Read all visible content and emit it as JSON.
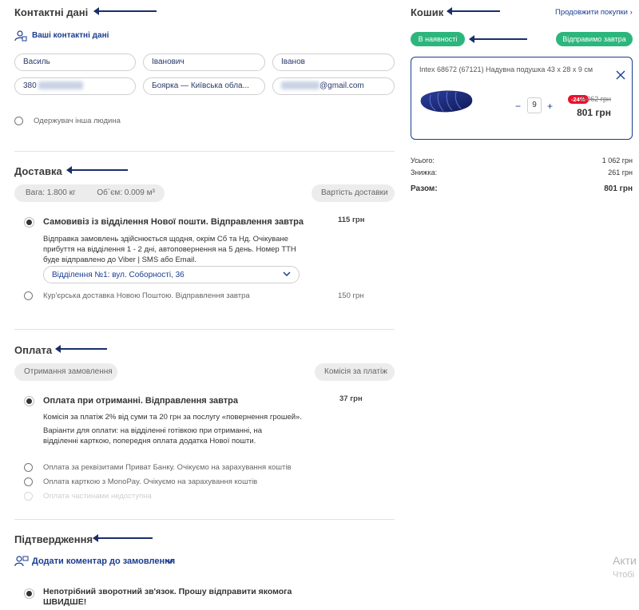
{
  "contacts": {
    "title": "Контактні дані",
    "your_contacts": "Ваші контактні дані",
    "first_name": "Василь",
    "patronymic": "Іванович",
    "last_name": "Іванов",
    "phone_prefix": "380",
    "city": "Боярка — Київська обла...",
    "email_suffix": "@gmail.com",
    "other_recipient": "Одержувач інша людина"
  },
  "delivery": {
    "title": "Доставка",
    "weight": "Вага: 1.800 кг",
    "volume": "Об`єм: 0.009 м³",
    "cost_button": "Вартість доставки",
    "option1": {
      "label": "Самовивіз із відділення Нової пошти. Відправлення завтра",
      "price": "115 грн",
      "description": "Відправка замовлень здійснюється щодня, окрім Сб та Нд. Очікуване прибуття на відділення 1 - 2 дні, автоповернення на 5 день. Номер ТТН буде відправлено до Viber | SMS або Email.",
      "branch": "Відділення №1: вул. Соборності, 36"
    },
    "option2": {
      "label": "Кур'єрська доставка Новою Поштою. Відправлення завтра",
      "price": "150 грн"
    }
  },
  "payment": {
    "title": "Оплата",
    "receive_button": "Отримання замовлення",
    "commission_button": "Комісія за платіж",
    "option1": {
      "label": "Оплата при отриманні. Відправлення завтра",
      "price": "37 грн",
      "line1": "Комісія за платіж 2% від суми та 20 грн за послугу «повернення грошей».",
      "line2": "Варіанти для оплати: на відділенні готівкою при отриманні, на відділенні карткою, попередня оплата додатка Нової пошти."
    },
    "option2": "Оплата за реквізитами Приват Банку. Очікуємо на зарахування коштів",
    "option3": "Оплата карткою з MonoPay. Очікуємо на зарахування коштів",
    "option4": "Оплата частинами недоступна"
  },
  "confirmation": {
    "title": "Підтвердження",
    "add_comment": "Додати коментар до замовлення",
    "no_callback": "Непотрібний зворотний зв'язок. Прошу відправити якомога ШВИДШЕ!"
  },
  "cart": {
    "title": "Кошик",
    "continue": "Продовжити покупки",
    "in_stock": "В наявності",
    "ship_tomorrow": "Відправимо завтра",
    "product_name": "Intex 68672 (67121) Надувна подушка 43 х 28 х 9 см",
    "quantity": "9",
    "discount_badge": "-24%",
    "old_price": "1 062 грн",
    "price": "801 грн",
    "total_label": "Усього:",
    "total_value": "1 062 грн",
    "discount_label": "Знижка:",
    "discount_value": "261 грн",
    "sum_label": "Разом:",
    "sum_value": "801 грн"
  },
  "watermark": {
    "line1": "Акти",
    "line2": "Чтобі"
  },
  "colors": {
    "accent_blue": "#1a3d8f",
    "green": "#2cb67d",
    "sale_red": "#e8112d"
  }
}
